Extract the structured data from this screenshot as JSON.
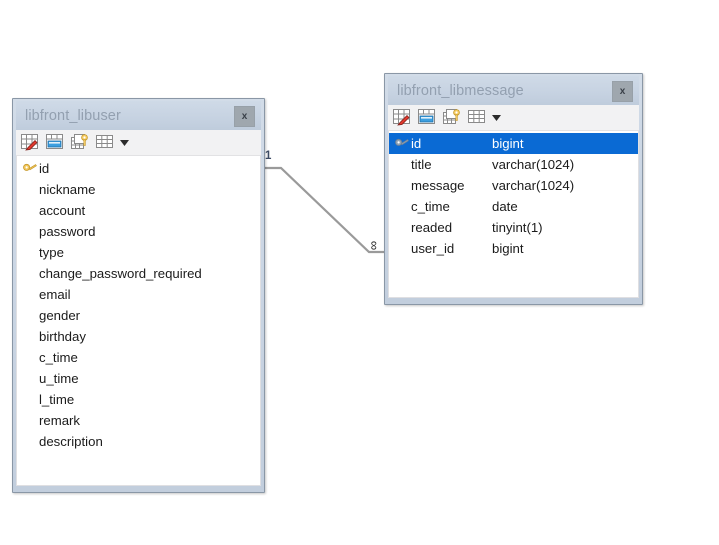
{
  "diagram": {
    "title": "Database ER Diagram",
    "background": "#ffffff",
    "accent_selection": "#0a6ad4",
    "frame_color": "#c2cedd",
    "title_text_color": "#93a0b0"
  },
  "entities": [
    {
      "id": "libuser",
      "title": "libfront_libuser",
      "close_label": "x",
      "toolbar": [
        {
          "name": "edit-table-icon",
          "tooltip": "Edit table"
        },
        {
          "name": "table-row-icon",
          "tooltip": "Table rows"
        },
        {
          "name": "table-key-icon",
          "tooltip": "Keys and indexes"
        },
        {
          "name": "table-view-icon",
          "tooltip": "Table view"
        },
        {
          "name": "chevron-down-icon",
          "tooltip": "More options"
        }
      ],
      "columns": [
        {
          "name": "id",
          "type": "",
          "key": true,
          "selected": false
        },
        {
          "name": "nickname",
          "type": "",
          "key": false,
          "selected": false
        },
        {
          "name": "account",
          "type": "",
          "key": false,
          "selected": false
        },
        {
          "name": "password",
          "type": "",
          "key": false,
          "selected": false
        },
        {
          "name": "type",
          "type": "",
          "key": false,
          "selected": false
        },
        {
          "name": "change_password_required",
          "type": "",
          "key": false,
          "selected": false
        },
        {
          "name": "email",
          "type": "",
          "key": false,
          "selected": false
        },
        {
          "name": "gender",
          "type": "",
          "key": false,
          "selected": false
        },
        {
          "name": "birthday",
          "type": "",
          "key": false,
          "selected": false
        },
        {
          "name": "c_time",
          "type": "",
          "key": false,
          "selected": false
        },
        {
          "name": "u_time",
          "type": "",
          "key": false,
          "selected": false
        },
        {
          "name": "l_time",
          "type": "",
          "key": false,
          "selected": false
        },
        {
          "name": "remark",
          "type": "",
          "key": false,
          "selected": false
        },
        {
          "name": "description",
          "type": "",
          "key": false,
          "selected": false
        }
      ]
    },
    {
      "id": "libmessage",
      "title": "libfront_libmessage",
      "close_label": "x",
      "toolbar": [
        {
          "name": "edit-table-icon",
          "tooltip": "Edit table"
        },
        {
          "name": "table-row-icon",
          "tooltip": "Table rows"
        },
        {
          "name": "table-key-icon",
          "tooltip": "Keys and indexes"
        },
        {
          "name": "table-view-icon",
          "tooltip": "Table view"
        },
        {
          "name": "chevron-down-icon",
          "tooltip": "More options"
        }
      ],
      "columns": [
        {
          "name": "id",
          "type": "bigint",
          "key": true,
          "selected": true
        },
        {
          "name": "title",
          "type": "varchar(1024)",
          "key": false,
          "selected": false
        },
        {
          "name": "message",
          "type": "varchar(1024)",
          "key": false,
          "selected": false
        },
        {
          "name": "c_time",
          "type": "date",
          "key": false,
          "selected": false
        },
        {
          "name": "readed",
          "type": "tinyint(1)",
          "key": false,
          "selected": false
        },
        {
          "name": "user_id",
          "type": "bigint",
          "key": false,
          "selected": false
        }
      ]
    }
  ],
  "relationship": {
    "from_entity": "libfront_libuser",
    "to_entity": "libfront_libmessage",
    "from_cardinality": "1",
    "to_cardinality": "∞",
    "line_color": "#9a9a9a"
  }
}
